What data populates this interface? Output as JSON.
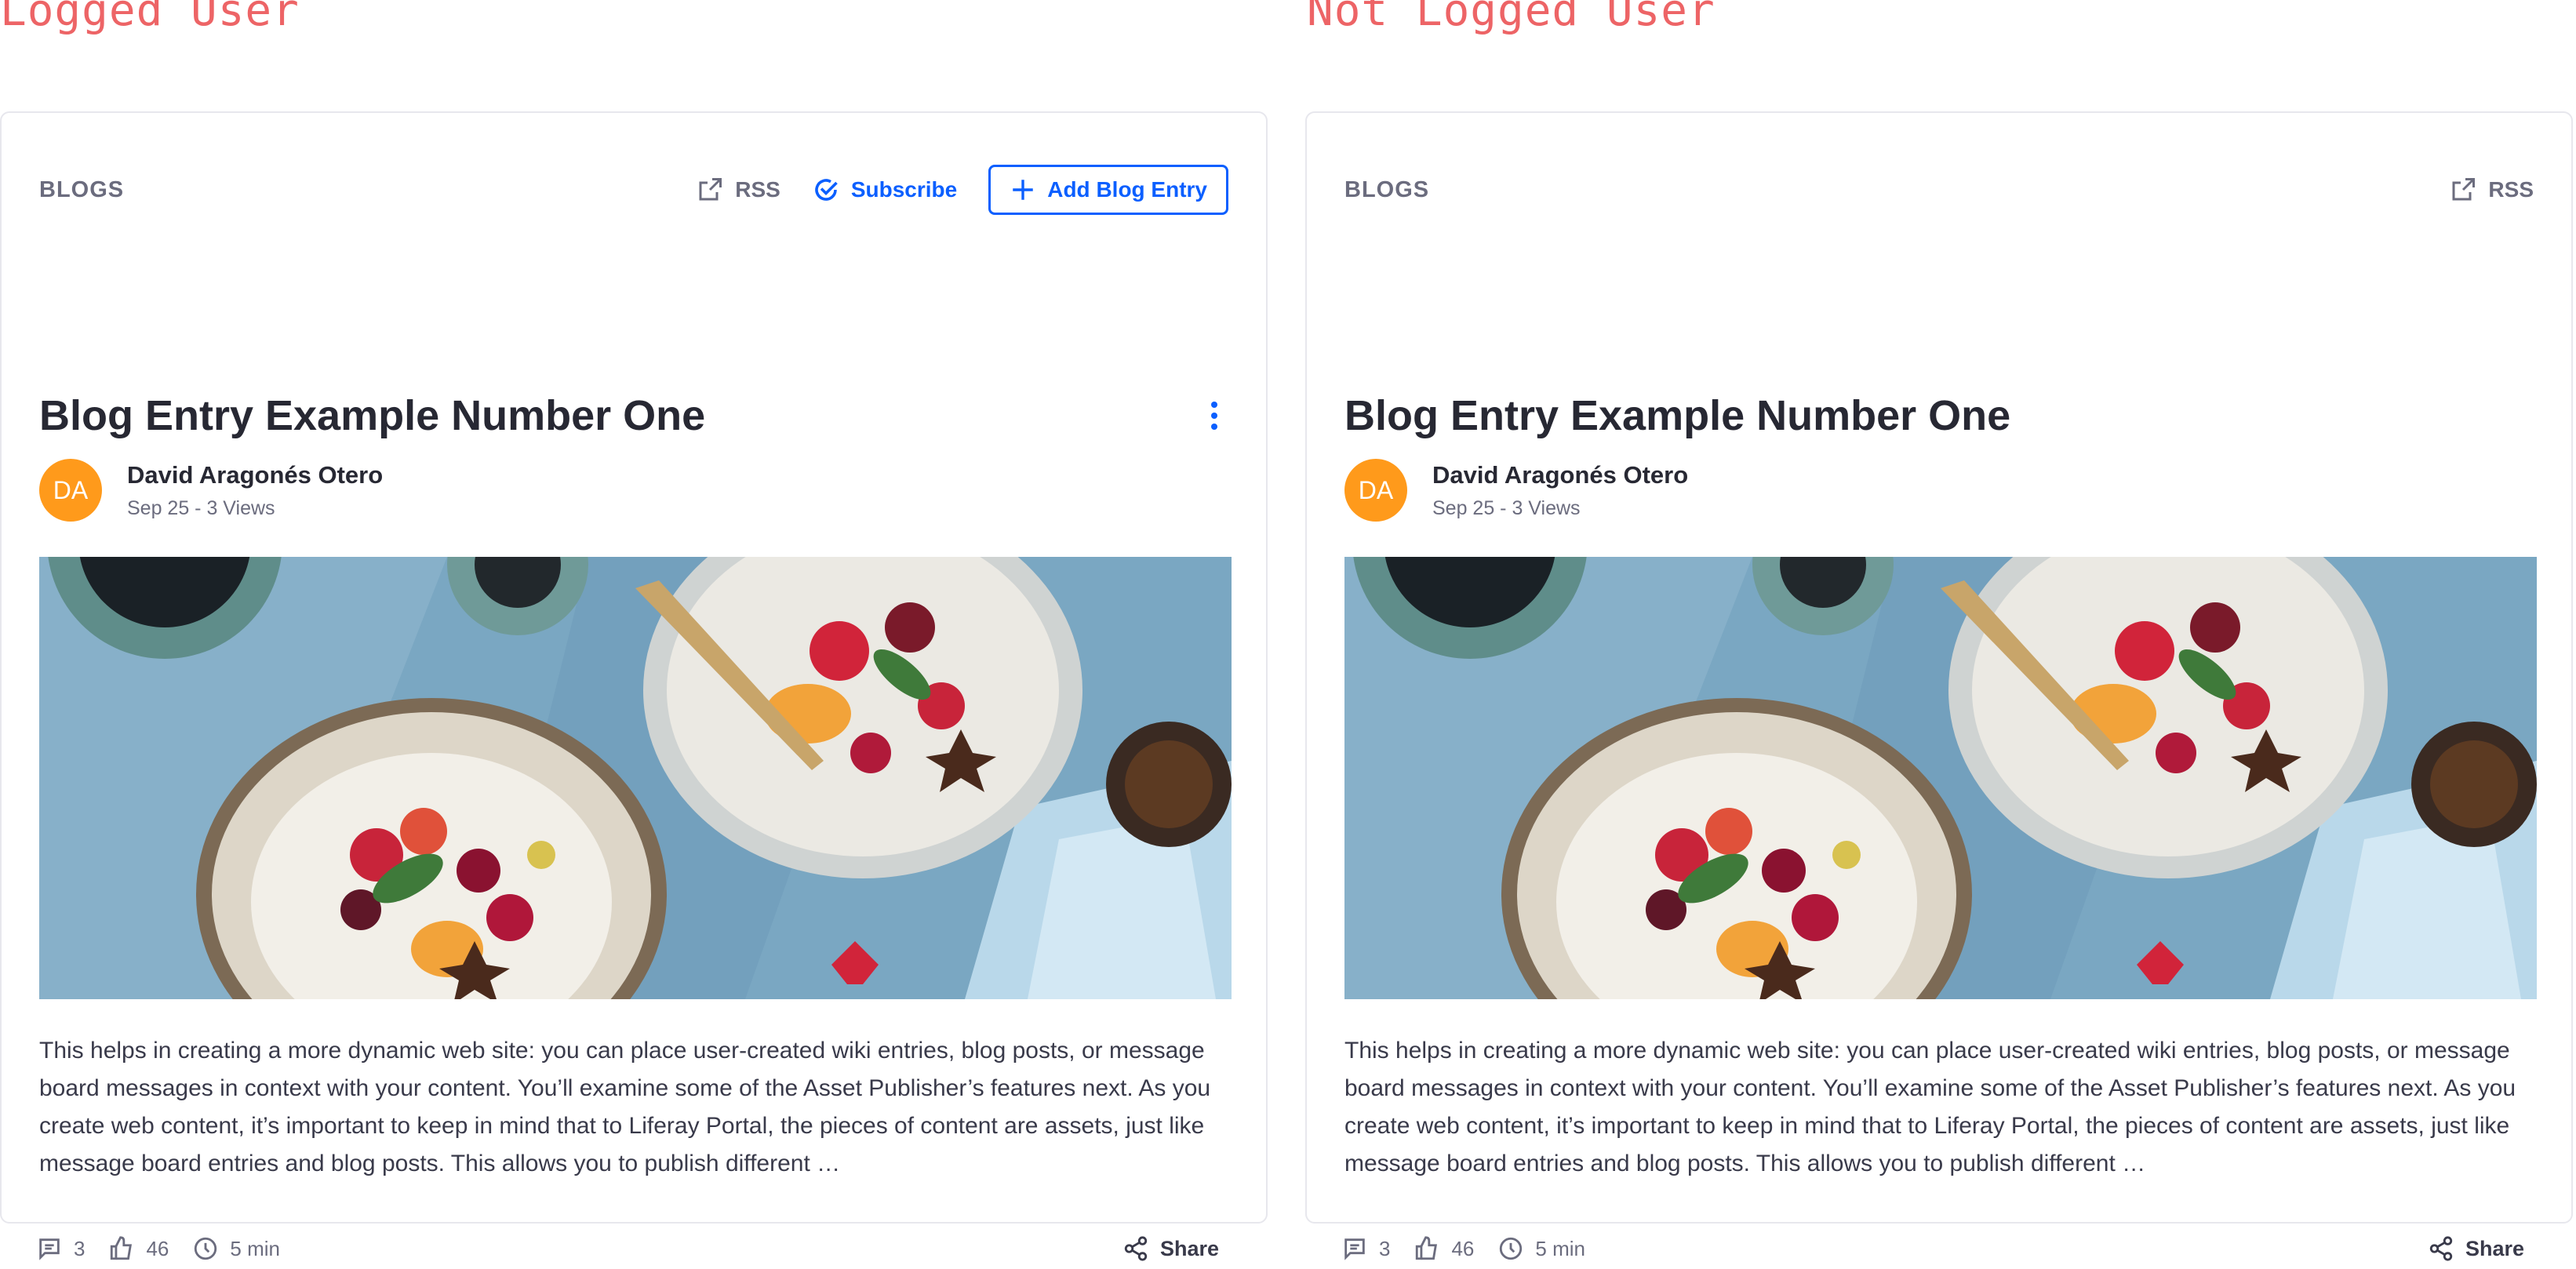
{
  "captions": {
    "logged": "Logged User",
    "not_logged": "Not Logged User"
  },
  "colors": {
    "caption": "#ed6466",
    "accent": "#0b5fff",
    "avatar": "#ff9a1b",
    "border": "#e7e7ed",
    "muted": "#6b6c7e",
    "heading": "#272833"
  },
  "cards": [
    {
      "section_label": "BLOGS",
      "rss_label": "RSS",
      "subscribe_label": "Subscribe",
      "add_entry_label": "Add Blog Entry",
      "title": "Blog Entry Example Number One",
      "author": {
        "initials": "DA",
        "name": "David Aragonés Otero"
      },
      "meta": "Sep 25  -  3 Views",
      "excerpt": "This helps in creating a more dynamic web site: you can place user-created wiki entries, blog posts, or message board messages in context with your content. You’ll examine some of the Asset Publisher’s features next. As you create web content, it’s important to keep in mind that to Liferay Portal, the pieces of content are assets, just like message board entries and blog posts. This allows you to publish different …",
      "stats": {
        "comments": "3",
        "likes": "46",
        "reading_time": "5 min"
      },
      "share_label": "Share"
    },
    {
      "section_label": "BLOGS",
      "rss_label": "RSS",
      "title": "Blog Entry Example Number One",
      "author": {
        "initials": "DA",
        "name": "David Aragonés Otero"
      },
      "meta": "Sep 25  -  3 Views",
      "excerpt": "This helps in creating a more dynamic web site: you can place user-created wiki entries, blog posts, or message board messages in context with your content. You’ll examine some of the Asset Publisher’s features next. As you create web content, it’s important to keep in mind that to Liferay Portal, the pieces of content are assets, just like message board entries and blog posts. This allows you to publish different …",
      "stats": {
        "comments": "3",
        "likes": "46",
        "reading_time": "5 min"
      },
      "share_label": "Share"
    }
  ],
  "icons": {
    "rss": "external-link-icon",
    "subscribe": "check-circle-icon",
    "add": "plus-icon",
    "options": "ellipsis-vertical-icon",
    "comments": "comment-icon",
    "likes": "thumbs-up-icon",
    "reading_time": "clock-icon",
    "share": "share-icon"
  }
}
